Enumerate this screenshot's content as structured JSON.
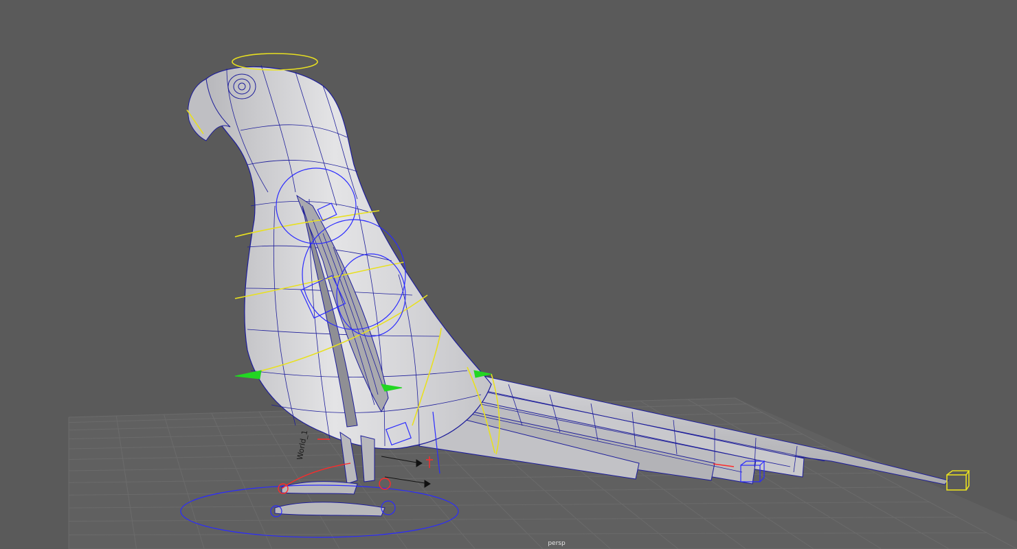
{
  "viewport": {
    "camera_label": "persp",
    "background_color": "#5a5a5a",
    "grid_color": "#6b6b6b",
    "mesh_fill_color": "#d2d2d4",
    "wireframe_color": "#1c1c9a",
    "control_colors": {
      "yellow": "#e8e020",
      "blue": "#2a2aff",
      "red": "#ff2a2a",
      "green": "#22d622"
    }
  },
  "scene": {
    "object": "parrot-rig",
    "world_label": "World_1"
  }
}
